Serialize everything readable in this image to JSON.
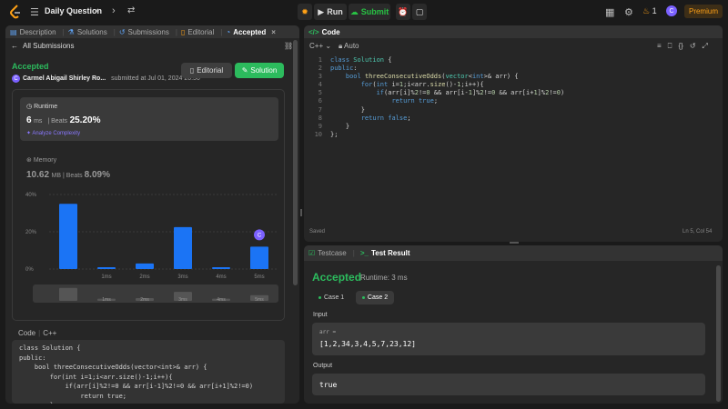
{
  "topbar": {
    "title": "Daily Question",
    "run": "Run",
    "submit": "Submit",
    "streak": "1",
    "avatar": "C",
    "premium": "Premium"
  },
  "left": {
    "tabs": [
      {
        "label": "Description"
      },
      {
        "label": "Solutions"
      },
      {
        "label": "Submissions"
      },
      {
        "label": "Editorial"
      },
      {
        "label": "Accepted"
      }
    ],
    "all_submissions": "All Submissions",
    "status": "Accepted",
    "author": "Carmel Abigail Shirley Ro...",
    "submitted_at": "submitted at Jul 01, 2024 20:50",
    "editorial_btn": "Editorial",
    "solution_btn": "Solution",
    "runtime_label": "Runtime",
    "runtime_value": "6",
    "runtime_unit": "ms",
    "beats_label": "Beats",
    "runtime_beats": "25.20%",
    "analyze": "Analyze Complexity",
    "memory_label": "Memory",
    "memory_value": "10.62",
    "memory_unit": "MB",
    "memory_beats": "8.09%",
    "code_header_code": "Code",
    "code_header_lang": "C++",
    "code": "class Solution {\npublic:\n    bool threeConsecutiveOdds(vector<int>& arr) {\n        for(int i=1;i<arr.size()-1;i++){\n            if(arr[i]%2!=0 && arr[i-1]%2!=0 && arr[i+1]%2!=0)\n                return true;\n        }"
  },
  "chart_data": {
    "type": "bar",
    "categories": [
      "",
      "1ms",
      "2ms",
      "3ms",
      "4ms",
      "5ms"
    ],
    "values": [
      35,
      1,
      3,
      22.5,
      1,
      12
    ],
    "y_ticks": [
      "40%",
      "20%",
      "0%"
    ],
    "ylim": [
      0,
      40
    ],
    "highlight_index": 5,
    "highlight_label": "C",
    "bar_color": "#1b74f5"
  },
  "code_panel": {
    "title": "Code",
    "lang": "C++",
    "auto": "Auto",
    "line_numbers": "1\n2\n3\n4\n5\n6\n7\n8\n9\n10",
    "saved": "Saved",
    "cursor": "Ln 5, Col 54"
  },
  "test_panel": {
    "tab_testcase": "Testcase",
    "tab_result": "Test Result",
    "status": "Accepted",
    "runtime": "Runtime: 3 ms",
    "case1": "Case 1",
    "case2": "Case 2",
    "input_label": "Input",
    "input_var": "arr =",
    "input_value": "[1,2,34,3,4,5,7,23,12]",
    "output_label": "Output",
    "output_value": "true"
  }
}
